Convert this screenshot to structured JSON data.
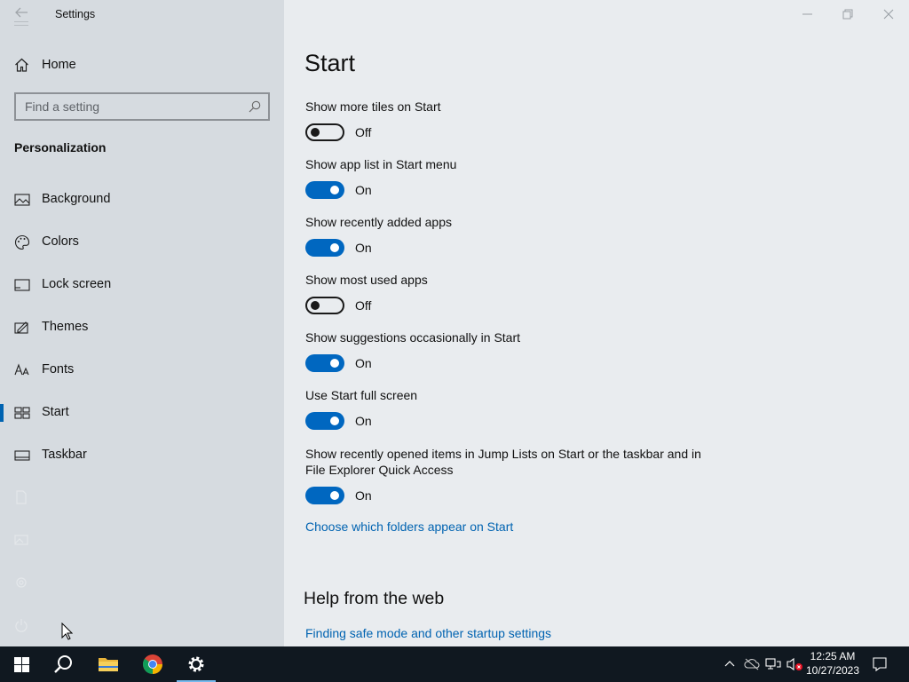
{
  "window": {
    "title": "Settings",
    "controls": [
      "minimize",
      "restore",
      "close"
    ]
  },
  "sidebar": {
    "home_label": "Home",
    "search_placeholder": "Find a setting",
    "section_title": "Personalization",
    "items": [
      {
        "label": "Background",
        "icon": "picture-icon"
      },
      {
        "label": "Colors",
        "icon": "palette-icon"
      },
      {
        "label": "Lock screen",
        "icon": "lock-screen-icon"
      },
      {
        "label": "Themes",
        "icon": "themes-icon"
      },
      {
        "label": "Fonts",
        "icon": "fonts-icon"
      },
      {
        "label": "Start",
        "icon": "start-icon",
        "active": true
      },
      {
        "label": "Taskbar",
        "icon": "taskbar-icon"
      }
    ]
  },
  "main": {
    "title": "Start",
    "settings": [
      {
        "label": "Show more tiles on Start",
        "state": "Off"
      },
      {
        "label": "Show app list in Start menu",
        "state": "On"
      },
      {
        "label": "Show recently added apps",
        "state": "On"
      },
      {
        "label": "Show most used apps",
        "state": "Off"
      },
      {
        "label": "Show suggestions occasionally in Start",
        "state": "On"
      },
      {
        "label": "Use Start full screen",
        "state": "On"
      },
      {
        "label": "Show recently opened items in Jump Lists on Start or the taskbar and in File Explorer Quick Access",
        "state": "On"
      }
    ],
    "folders_link": "Choose which folders appear on Start",
    "help_title": "Help from the web",
    "help_link": "Finding safe mode and other startup settings"
  },
  "taskbar": {
    "apps": [
      "start-button",
      "search-button",
      "file-explorer",
      "chrome",
      "settings"
    ],
    "time": "12:25 AM",
    "date": "10/27/2023"
  },
  "colors": {
    "accent": "#0067c0",
    "link": "#0063b1",
    "sidebar_bg": "#d6dbe0",
    "main_bg": "#e9ecef",
    "taskbar_bg": "#101820"
  }
}
